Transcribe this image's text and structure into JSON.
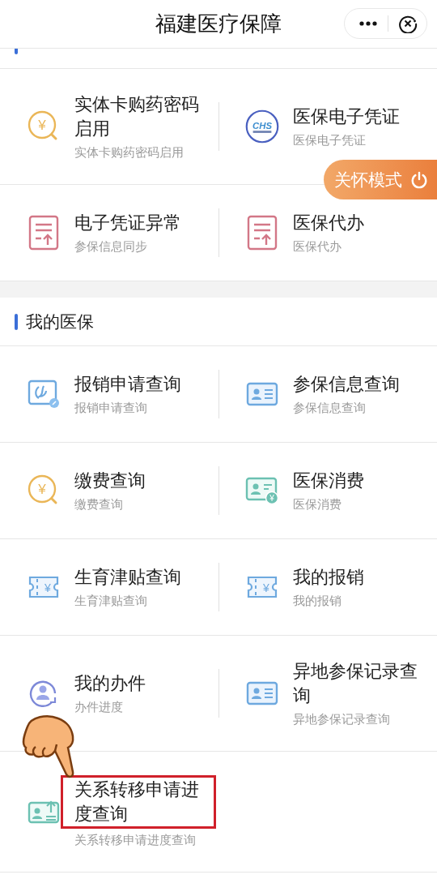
{
  "header": {
    "title": "福建医疗保障"
  },
  "top_items": [
    {
      "title": "实体卡购药密码启用",
      "subtitle": "实体卡购药密码启用",
      "kind": "coin",
      "icon_glyph": "¥"
    },
    {
      "title": "医保电子凭证",
      "subtitle": "医保电子凭证",
      "kind": "logo",
      "icon_glyph": "CHS"
    },
    {
      "title": "电子凭证异常",
      "subtitle": "参保信息同步",
      "kind": "document"
    },
    {
      "title": "医保代办",
      "subtitle": "医保代办",
      "kind": "document"
    }
  ],
  "care_mode_button": {
    "label": "关怀模式"
  },
  "section": {
    "title": "我的医保",
    "items": [
      {
        "title": "报销申请查询",
        "subtitle": "报销申请查询",
        "kind": "reimburse"
      },
      {
        "title": "参保信息查询",
        "subtitle": "参保信息查询",
        "kind": "card"
      },
      {
        "title": "缴费查询",
        "subtitle": "缴费查询",
        "kind": "coin",
        "icon_glyph": "¥"
      },
      {
        "title": "医保消费",
        "subtitle": "医保消费",
        "kind": "paycard",
        "icon_glyph": "¥"
      },
      {
        "title": "生育津贴查询",
        "subtitle": "生育津贴查询",
        "kind": "ticket",
        "icon_glyph": "¥"
      },
      {
        "title": "我的报销",
        "subtitle": "我的报销",
        "kind": "ticket",
        "icon_glyph": "¥"
      },
      {
        "title": "我的办件",
        "subtitle": "办件进度",
        "kind": "person"
      },
      {
        "title": "异地参保记录查询",
        "subtitle": "异地参保记录查询",
        "kind": "card"
      },
      {
        "title": "关系转移申请进度查询",
        "subtitle": "关系转移申请进度查询",
        "kind": "transfer",
        "highlighted": true
      }
    ]
  }
}
